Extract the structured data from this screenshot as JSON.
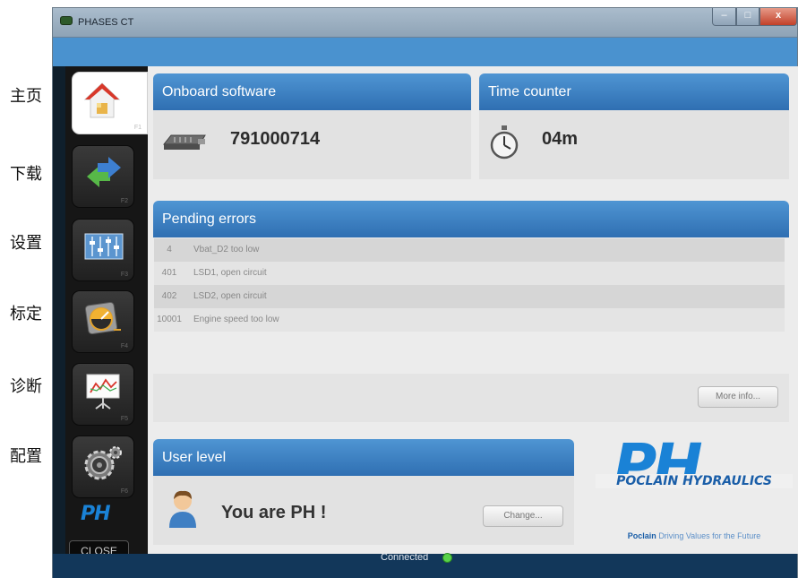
{
  "annotations": [
    "主页",
    "下载",
    "设置",
    "标定",
    "诊断",
    "配置"
  ],
  "window": {
    "title": "PHASES CT",
    "minimize": "–",
    "maximize": "□",
    "close": "x"
  },
  "sidebar": {
    "items": [
      {
        "icon": "home-icon",
        "fkey": "F1"
      },
      {
        "icon": "download-arrows-icon",
        "fkey": "F2"
      },
      {
        "icon": "settings-sliders-icon",
        "fkey": "F3"
      },
      {
        "icon": "calibration-gauge-icon",
        "fkey": "F4"
      },
      {
        "icon": "diagnosis-chart-icon",
        "fkey": "F5"
      },
      {
        "icon": "configuration-gears-icon",
        "fkey": "F6"
      }
    ],
    "logo": "PH",
    "close_label": "CLOSE"
  },
  "onboard": {
    "title": "Onboard software",
    "value": "791000714",
    "icon": "ecu-icon"
  },
  "time_counter": {
    "title": "Time counter",
    "value": "04m",
    "icon": "stopwatch-icon"
  },
  "errors": {
    "title": "Pending errors",
    "rows": [
      {
        "code": "4",
        "desc": "Vbat_D2 too low"
      },
      {
        "code": "401",
        "desc": "LSD1, open circuit"
      },
      {
        "code": "402",
        "desc": "LSD2, open circuit"
      },
      {
        "code": "10001",
        "desc": "Engine speed too low"
      }
    ],
    "more_label": "More info..."
  },
  "user_level": {
    "title": "User level",
    "text": "You are PH !",
    "change_label": "Change...",
    "icon": "user-avatar-icon"
  },
  "brand": {
    "big": "PH",
    "name": "POCLAIN HYDRAULICS",
    "sub_brand": "Poclain",
    "tagline": "Driving Values for the Future"
  },
  "status": {
    "text": "Connected",
    "color": "#59d24a"
  },
  "colors": {
    "header_blue": "#3f83c4",
    "status_bar": "#12375a",
    "logo_blue": "#1a82d6"
  }
}
